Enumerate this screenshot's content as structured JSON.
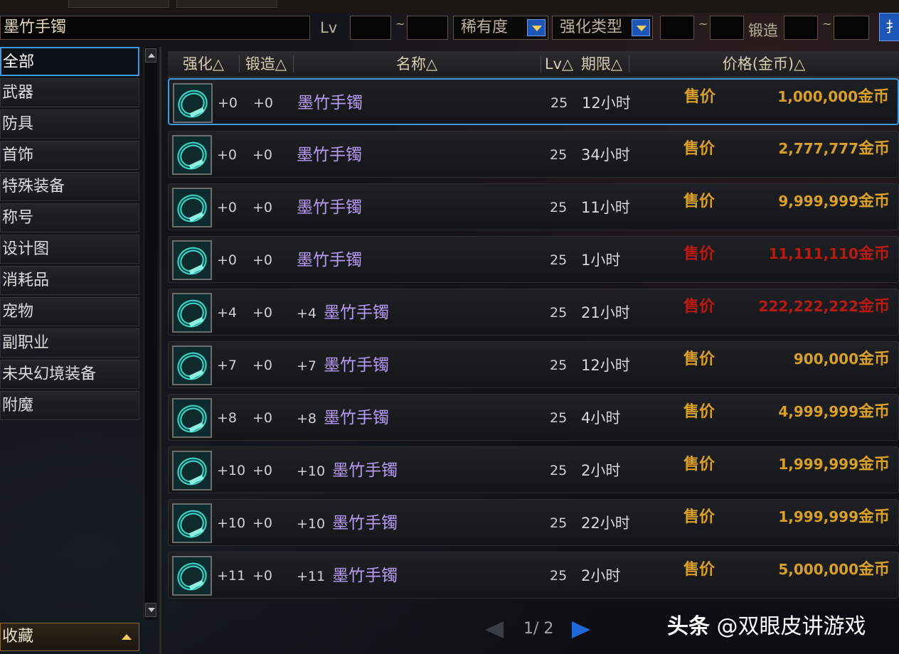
{
  "filter": {
    "name_value": "墨竹手镯",
    "lv_label": "Lv",
    "rarity_label": "稀有度",
    "enhance_type_label": "强化类型",
    "forge_label": "锻造",
    "range_sep": "~",
    "search_label": "扌"
  },
  "sidebar": {
    "items": [
      {
        "label": "全部",
        "active": true
      },
      {
        "label": "武器"
      },
      {
        "label": "防具"
      },
      {
        "label": "首饰"
      },
      {
        "label": "特殊装备"
      },
      {
        "label": "称号"
      },
      {
        "label": "设计图"
      },
      {
        "label": "消耗品"
      },
      {
        "label": "宠物"
      },
      {
        "label": "副职业"
      },
      {
        "label": "未央幻境装备"
      },
      {
        "label": "附魔"
      }
    ],
    "favorites_label": "收藏"
  },
  "table": {
    "headers": {
      "enhance": "强化△",
      "forge": "锻造△",
      "name": "名称△",
      "lv": "Lv△",
      "duration": "期限△",
      "price": "价格(金币)△"
    },
    "sell_label": "售价",
    "currency": "金币",
    "rows": [
      {
        "enhance": "+0",
        "forge": "+0",
        "prefix": "",
        "name": "墨竹手镯",
        "lv": "25",
        "duration": "12小时",
        "price": "1,000,000",
        "red": false,
        "selected": true
      },
      {
        "enhance": "+0",
        "forge": "+0",
        "prefix": "",
        "name": "墨竹手镯",
        "lv": "25",
        "duration": "34小时",
        "price": "2,777,777",
        "red": false
      },
      {
        "enhance": "+0",
        "forge": "+0",
        "prefix": "",
        "name": "墨竹手镯",
        "lv": "25",
        "duration": "11小时",
        "price": "9,999,999",
        "red": false
      },
      {
        "enhance": "+0",
        "forge": "+0",
        "prefix": "",
        "name": "墨竹手镯",
        "lv": "25",
        "duration": "1小时",
        "price": "11,111,110",
        "red": true
      },
      {
        "enhance": "+4",
        "forge": "+0",
        "prefix": "+4",
        "name": "墨竹手镯",
        "lv": "25",
        "duration": "21小时",
        "price": "222,222,222",
        "red": true
      },
      {
        "enhance": "+7",
        "forge": "+0",
        "prefix": "+7",
        "name": "墨竹手镯",
        "lv": "25",
        "duration": "12小时",
        "price": "900,000",
        "red": false
      },
      {
        "enhance": "+8",
        "forge": "+0",
        "prefix": "+8",
        "name": "墨竹手镯",
        "lv": "25",
        "duration": "4小时",
        "price": "4,999,999",
        "red": false
      },
      {
        "enhance": "+10",
        "forge": "+0",
        "prefix": "+10",
        "name": "墨竹手镯",
        "lv": "25",
        "duration": "2小时",
        "price": "1,999,999",
        "red": false
      },
      {
        "enhance": "+10",
        "forge": "+0",
        "prefix": "+10",
        "name": "墨竹手镯",
        "lv": "25",
        "duration": "22小时",
        "price": "1,999,999",
        "red": false
      },
      {
        "enhance": "+11",
        "forge": "+0",
        "prefix": "+11",
        "name": "墨竹手镯",
        "lv": "25",
        "duration": "2小时",
        "price": "5,000,000",
        "red": false
      }
    ]
  },
  "pagination": {
    "current": "1",
    "total": "2",
    "text": "1/ 2"
  },
  "watermark": {
    "brand": "头条",
    "handle": "@双眼皮讲游戏"
  },
  "colors": {
    "accent": "#3b9ae0",
    "gold": "#d8a02a",
    "red_price": "#b81a14",
    "item_purple": "#b49cf0"
  },
  "icons": {
    "item": "bracelet-icon"
  }
}
